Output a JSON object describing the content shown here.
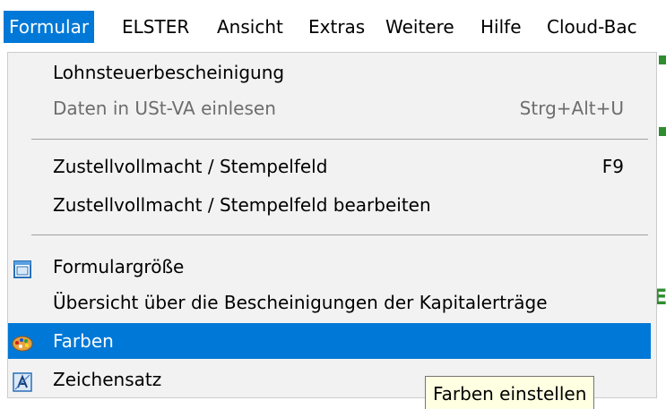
{
  "menubar": {
    "items": [
      {
        "label": "Formular",
        "active": true
      },
      {
        "label": "ELSTER"
      },
      {
        "label": "Ansicht"
      },
      {
        "label": "Extras"
      },
      {
        "label": "Weitere"
      },
      {
        "label": "Hilfe"
      },
      {
        "label": "Cloud-Bac"
      }
    ]
  },
  "dropdown": {
    "items": [
      {
        "label": "Lohnsteuerbescheinigung"
      },
      {
        "label": "Daten in USt-VA einlesen",
        "shortcut": "Strg+Alt+U",
        "disabled": true
      },
      {
        "label": "Zustellvollmacht / Stempelfeld",
        "shortcut": "F9"
      },
      {
        "label": "Zustellvollmacht / Stempelfeld bearbeiten"
      },
      {
        "label": "Formulargröße",
        "icon": "window-icon"
      },
      {
        "label": "Übersicht über die Bescheinigungen der Kapitalerträge"
      },
      {
        "label": "Farben",
        "icon": "palette-icon",
        "highlighted": true
      },
      {
        "label": "Zeichensatz",
        "icon": "font-icon"
      }
    ]
  },
  "tooltip": {
    "text": "Farben einstellen"
  },
  "colors": {
    "highlight": "#0078d7",
    "menu_bg": "#f2f2f2",
    "tooltip_bg": "#ffffe1",
    "disabled_text": "#6d6d6d"
  }
}
